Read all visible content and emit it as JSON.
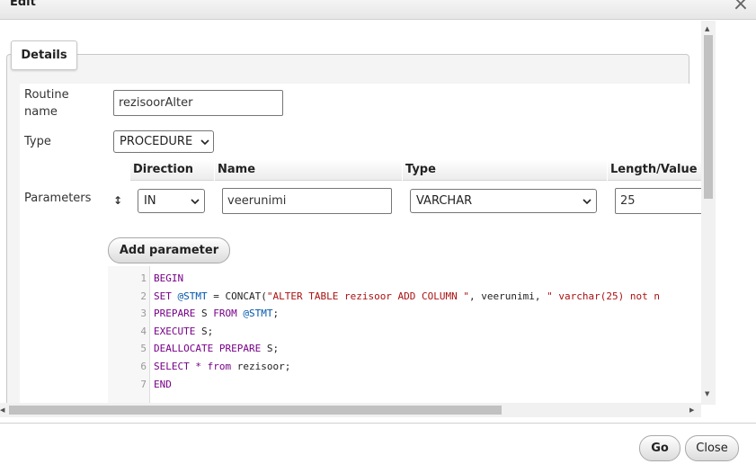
{
  "dialog": {
    "title": "Edit",
    "close_icon": "close-icon"
  },
  "tabs": [
    {
      "label": "Details"
    }
  ],
  "form": {
    "routine_name_label": "Routine name",
    "routine_name_value": "rezisoorAlter",
    "type_label": "Type",
    "type_value": "PROCEDURE",
    "parameters_label": "Parameters"
  },
  "parameters": {
    "headers": {
      "direction": "Direction",
      "name": "Name",
      "type": "Type",
      "length": "Length/Value"
    },
    "rows": [
      {
        "drag_handle": "↕",
        "direction": "IN",
        "name": "veerunimi",
        "type": "VARCHAR",
        "length": "25"
      }
    ],
    "add_label": "Add parameter"
  },
  "editor": {
    "line_numbers": [
      "1",
      "2",
      "3",
      "4",
      "5",
      "6",
      "7"
    ],
    "lines": [
      {
        "a": "BEGIN"
      },
      {
        "a": "SET",
        "b": " ",
        "c": "@STMT",
        "d": " = CONCAT(",
        "e": "\"ALTER TABLE rezisoor ADD COLUMN \"",
        "f": ", veerunimi, ",
        "g": "\" varchar(25) not n"
      },
      {
        "a": "PREPARE",
        "b": " S ",
        "c": "FROM",
        "d": " ",
        "e": "@STMT",
        "f": ";"
      },
      {
        "a": "EXECUTE",
        "b": " S;"
      },
      {
        "a": "DEALLOCATE PREPARE",
        "b": " S;"
      },
      {
        "a": "SELECT",
        "b": " ",
        "c": "*",
        "d": " ",
        "e": "from",
        "f": " rezisoor;"
      },
      {
        "a": "END"
      }
    ]
  },
  "footer": {
    "go_label": "Go",
    "close_label": "Close"
  }
}
